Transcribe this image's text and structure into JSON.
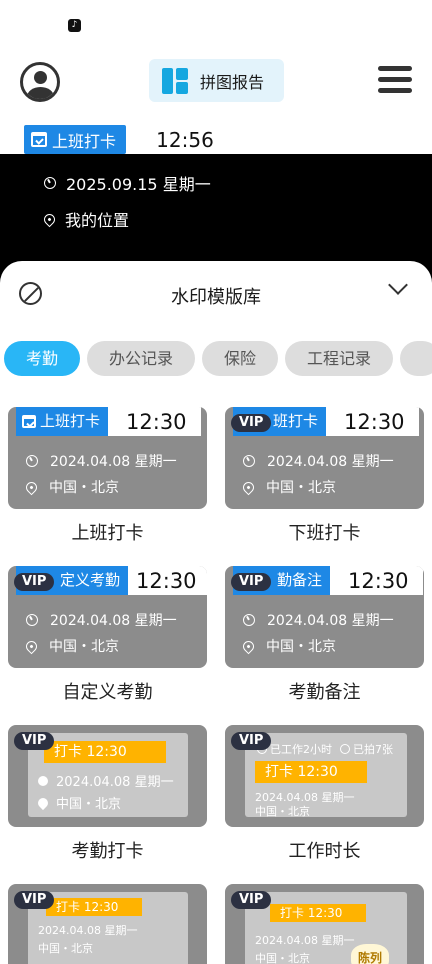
{
  "status_bar": {
    "app_icon": "tiktok-icon"
  },
  "header": {
    "avatar_icon": "user-avatar-icon",
    "collage_label": "拼图报告",
    "menu_icon": "hamburger-menu-icon",
    "accent": "#15a7e0"
  },
  "preview": {
    "badge": "上班打卡",
    "time": "12:56",
    "date": "2025.09.15 星期一",
    "location": "我的位置"
  },
  "sheet": {
    "title": "水印模版库",
    "tabs": [
      {
        "label": "考勤",
        "active": true
      },
      {
        "label": "办公记录",
        "active": false
      },
      {
        "label": "保险",
        "active": false
      },
      {
        "label": "工程记录",
        "active": false
      }
    ],
    "templates": [
      {
        "caption": "上班打卡",
        "tag": "上班打卡",
        "time": "12:30",
        "date": "2024.04.08 星期一",
        "location": "中国・北京",
        "vip": ""
      },
      {
        "caption": "下班打卡",
        "tag": "班打卡",
        "time": "12:30",
        "date": "2024.04.08 星期一",
        "location": "中国・北京",
        "vip": "VIP"
      },
      {
        "caption": "自定义考勤",
        "tag": "定义考勤",
        "time": "12:30",
        "date": "2024.04.08 星期一",
        "location": "中国・北京",
        "vip": "VIP"
      },
      {
        "caption": "考勤备注",
        "tag": "勤备注",
        "time": "12:30",
        "date": "2024.04.08 星期一",
        "location": "中国・北京",
        "vip": "VIP"
      },
      {
        "caption": "考勤打卡",
        "bar": "打卡 12:30",
        "date": "2024.04.08 星期一",
        "location": "中国・北京",
        "vip": "VIP"
      },
      {
        "caption": "工作时长",
        "chip1": "已工作2小时",
        "chip2": "已拍7张",
        "bar": "打卡 12:30",
        "date": "2024.04.08 星期一",
        "location": "中国・北京",
        "vip": "VIP"
      },
      {
        "bar": "打卡 12:30",
        "date": "2024.04.08 星期一",
        "location": "中国・北京",
        "vip": "VIP"
      },
      {
        "bar": "打卡 12:30",
        "date": "2024.04.08 星期一",
        "location": "中国・北京",
        "stamp": "陈列",
        "vip": "VIP"
      }
    ]
  }
}
